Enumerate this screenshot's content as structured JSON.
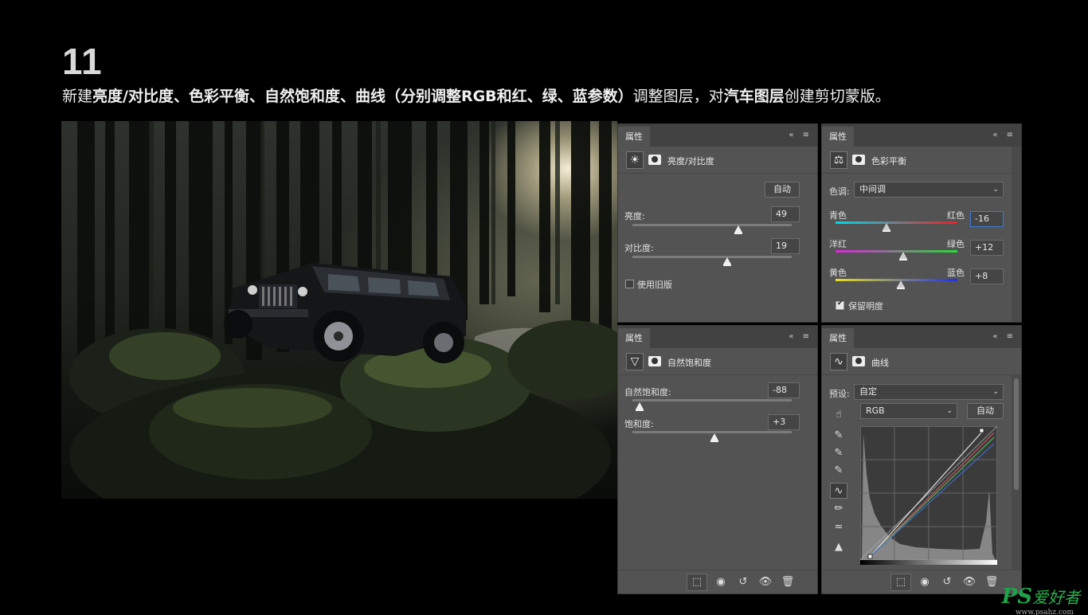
{
  "header": {
    "step": "11",
    "instruction_parts": [
      {
        "text": "新建",
        "bold": false
      },
      {
        "text": "亮度/对比度、色彩平衡、自然饱和度、曲线（分别调整RGB和红、绿、蓝参数）",
        "bold": true
      },
      {
        "text": "调整图层，对",
        "bold": false
      },
      {
        "text": "汽车图层",
        "bold": true
      },
      {
        "text": "创建剪切蒙版。",
        "bold": false
      }
    ]
  },
  "panel_tab_label": "属性",
  "brightness_panel": {
    "title": "亮度/对比度",
    "icon": "sun-icon",
    "auto_button": "自动",
    "brightness_label": "亮度:",
    "brightness_value": "49",
    "contrast_label": "对比度:",
    "contrast_value": "19",
    "legacy_label": "使用旧版",
    "legacy_checked": false
  },
  "color_balance_panel": {
    "title": "色彩平衡",
    "icon": "balance-scale-icon",
    "tone_label": "色调:",
    "tone_value": "中间调",
    "sliders": [
      {
        "left": "青色",
        "right": "红色",
        "value": "-16",
        "level": -16
      },
      {
        "left": "洋红",
        "right": "绿色",
        "value": "+12",
        "level": 12
      },
      {
        "left": "黄色",
        "right": "蓝色",
        "value": "+8",
        "level": 8
      }
    ],
    "preserve_label": "保留明度",
    "preserve_checked": true
  },
  "vibrance_panel": {
    "title": "自然饱和度",
    "icon": "triangle-icon",
    "vibrance_label": "自然饱和度:",
    "vibrance_value": "-88",
    "saturation_label": "饱和度:",
    "saturation_value": "+3"
  },
  "curves_panel": {
    "title": "曲线",
    "icon": "curves-icon",
    "preset_label": "预设:",
    "preset_value": "自定",
    "channel_value": "RGB",
    "auto_button": "自动"
  },
  "watermark": {
    "brand": "PS",
    "text": "爱好者",
    "url": "www.psahz.com"
  },
  "colors": {
    "panel_bg": "#535353",
    "selected_field_border": "#3d7bd8",
    "watermark_green": "#1fa34a"
  }
}
